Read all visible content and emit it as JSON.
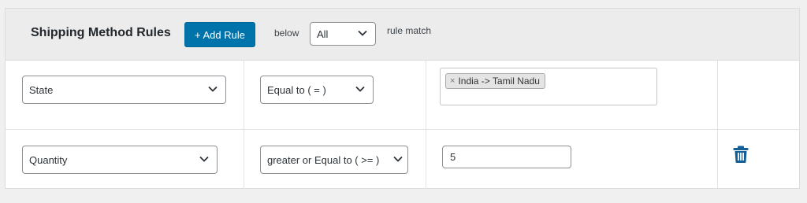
{
  "header": {
    "title": "Shipping Method Rules",
    "add_rule_label": "+ Add Rule",
    "below_label": "below",
    "match_select_value": "All",
    "rule_match_label": "rule match"
  },
  "rules": [
    {
      "field": "State",
      "operator": "Equal to ( = )",
      "value_tags": [
        "India -> Tamil Nadu"
      ],
      "tag_remove_glyph": "×"
    },
    {
      "field": "Quantity",
      "operator": "greater or Equal to ( >= )",
      "value": "5"
    }
  ],
  "icons": {
    "delete": "trash-icon",
    "dropdown": "chevron-down-icon"
  },
  "colors": {
    "primary_button": "#0073aa",
    "trash_icon": "#135e96"
  }
}
